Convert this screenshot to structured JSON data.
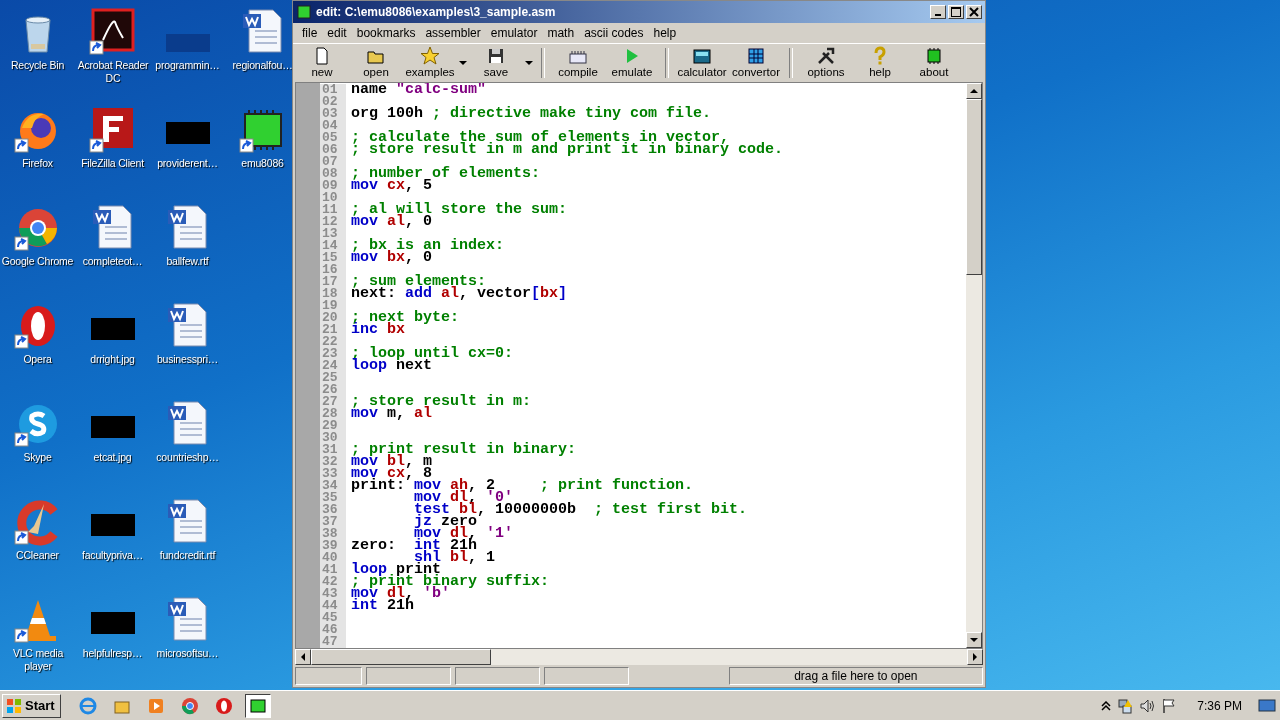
{
  "desktop_icons": [
    {
      "label": "Recycle Bin",
      "kind": "recycle",
      "shortcut": false
    },
    {
      "label": "Firefox",
      "kind": "firefox",
      "shortcut": true
    },
    {
      "label": "Google Chrome",
      "kind": "chrome",
      "shortcut": true
    },
    {
      "label": "Opera",
      "kind": "opera",
      "shortcut": true
    },
    {
      "label": "Skype",
      "kind": "skype",
      "shortcut": true
    },
    {
      "label": "CCleaner",
      "kind": "cleaner",
      "shortcut": true
    },
    {
      "label": "VLC media player",
      "kind": "cone",
      "shortcut": true
    },
    {
      "label": "Acrobat Reader DC",
      "kind": "pdf",
      "shortcut": true
    },
    {
      "label": "FileZilla Client",
      "kind": "ftp",
      "shortcut": true
    },
    {
      "label": "completeot…",
      "kind": "word",
      "shortcut": false
    },
    {
      "label": "drright.jpg",
      "kind": "blackout",
      "shortcut": false
    },
    {
      "label": "etcat.jpg",
      "kind": "blackout",
      "shortcut": false
    },
    {
      "label": "facultypriva…",
      "kind": "blackout",
      "shortcut": false
    },
    {
      "label": "helpfulresp…",
      "kind": "blackout",
      "shortcut": false
    },
    {
      "label": "programmin…",
      "kind": "dark",
      "shortcut": false
    },
    {
      "label": "providerent…",
      "kind": "blackout",
      "shortcut": false
    },
    {
      "label": "ballfew.rtf",
      "kind": "word",
      "shortcut": false
    },
    {
      "label": "businesspri…",
      "kind": "word",
      "shortcut": false
    },
    {
      "label": "countrieshp…",
      "kind": "word",
      "shortcut": false
    },
    {
      "label": "fundcredit.rtf",
      "kind": "word",
      "shortcut": false
    },
    {
      "label": "microsoftsu…",
      "kind": "word",
      "shortcut": false
    },
    {
      "label": "regionalfou…",
      "kind": "word",
      "shortcut": false
    },
    {
      "label": "emu8086",
      "kind": "chip",
      "shortcut": true
    }
  ],
  "window": {
    "title": "edit: C:\\emu8086\\examples\\3_sample.asm",
    "menu": [
      "file",
      "edit",
      "bookmarks",
      "assembler",
      "emulator",
      "math",
      "ascii codes",
      "help"
    ],
    "toolbar": [
      [
        {
          "label": "new",
          "kind": "page",
          "dropdown": false
        },
        {
          "label": "open",
          "kind": "folder",
          "dropdown": false
        },
        {
          "label": "examples",
          "kind": "star",
          "dropdown": true
        },
        {
          "label": "save",
          "kind": "disk",
          "dropdown": true
        }
      ],
      [
        {
          "label": "compile",
          "kind": "keyboard",
          "dropdown": false
        },
        {
          "label": "emulate",
          "kind": "play",
          "dropdown": false
        }
      ],
      [
        {
          "label": "calculator",
          "kind": "calc",
          "dropdown": false
        },
        {
          "label": "convertor",
          "kind": "grid",
          "dropdown": false
        }
      ],
      [
        {
          "label": "options",
          "kind": "tools",
          "dropdown": false
        },
        {
          "label": "help",
          "kind": "question",
          "dropdown": false
        },
        {
          "label": "about",
          "kind": "chip",
          "dropdown": false
        }
      ]
    ],
    "code_lines": [
      {
        "number": "01",
        "tokens": [
          {
            "kind": "plain",
            "text": "name "
          },
          {
            "kind": "string",
            "text": "\"calc-sum\""
          }
        ]
      },
      {
        "number": "02"
      },
      {
        "number": "03",
        "tokens": [
          {
            "kind": "plain",
            "text": "org 100h "
          },
          {
            "kind": "comment",
            "text": "; directive make tiny com file."
          }
        ]
      },
      {
        "number": "04"
      },
      {
        "number": "05",
        "tokens": [
          {
            "kind": "comment",
            "text": "; calculate the sum of elements in vector,"
          }
        ]
      },
      {
        "number": "06",
        "tokens": [
          {
            "kind": "comment",
            "text": "; store result in m and print it in binary code."
          }
        ]
      },
      {
        "number": "07"
      },
      {
        "number": "08",
        "tokens": [
          {
            "kind": "comment",
            "text": "; number of elements:"
          }
        ]
      },
      {
        "number": "09",
        "tokens": [
          {
            "kind": "keyword",
            "text": "mov "
          },
          {
            "kind": "register",
            "text": "cx"
          },
          {
            "kind": "plain",
            "text": ", 5"
          }
        ]
      },
      {
        "number": "10"
      },
      {
        "number": "11",
        "tokens": [
          {
            "kind": "comment",
            "text": "; al will store the sum:"
          }
        ]
      },
      {
        "number": "12",
        "tokens": [
          {
            "kind": "keyword",
            "text": "mov "
          },
          {
            "kind": "register",
            "text": "al"
          },
          {
            "kind": "plain",
            "text": ", 0"
          }
        ]
      },
      {
        "number": "13"
      },
      {
        "number": "14",
        "tokens": [
          {
            "kind": "comment",
            "text": "; bx is an index:"
          }
        ]
      },
      {
        "number": "15",
        "tokens": [
          {
            "kind": "keyword",
            "text": "mov "
          },
          {
            "kind": "register",
            "text": "bx"
          },
          {
            "kind": "plain",
            "text": ", 0"
          }
        ]
      },
      {
        "number": "16"
      },
      {
        "number": "17",
        "tokens": [
          {
            "kind": "comment",
            "text": "; sum elements:"
          }
        ]
      },
      {
        "number": "18",
        "tokens": [
          {
            "kind": "plain",
            "text": "next: "
          },
          {
            "kind": "keyword",
            "text": "add "
          },
          {
            "kind": "register",
            "text": "al"
          },
          {
            "kind": "plain",
            "text": ", vector"
          },
          {
            "kind": "keyword",
            "text": "["
          },
          {
            "kind": "register",
            "text": "bx"
          },
          {
            "kind": "keyword",
            "text": "]"
          }
        ]
      },
      {
        "number": "19"
      },
      {
        "number": "20",
        "tokens": [
          {
            "kind": "comment",
            "text": "; next byte:"
          }
        ]
      },
      {
        "number": "21",
        "tokens": [
          {
            "kind": "keyword",
            "text": "inc "
          },
          {
            "kind": "register",
            "text": "bx"
          }
        ]
      },
      {
        "number": "22"
      },
      {
        "number": "23",
        "tokens": [
          {
            "kind": "comment",
            "text": "; loop until cx=0:"
          }
        ]
      },
      {
        "number": "24",
        "tokens": [
          {
            "kind": "keyword",
            "text": "loop "
          },
          {
            "kind": "plain",
            "text": "next"
          }
        ]
      },
      {
        "number": "25"
      },
      {
        "number": "26"
      },
      {
        "number": "27",
        "tokens": [
          {
            "kind": "comment",
            "text": "; store result in m:"
          }
        ]
      },
      {
        "number": "28",
        "tokens": [
          {
            "kind": "keyword",
            "text": "mov "
          },
          {
            "kind": "plain",
            "text": "m, "
          },
          {
            "kind": "register",
            "text": "al"
          }
        ]
      },
      {
        "number": "29"
      },
      {
        "number": "30"
      },
      {
        "number": "31",
        "tokens": [
          {
            "kind": "comment",
            "text": "; print result in binary:"
          }
        ]
      },
      {
        "number": "32",
        "tokens": [
          {
            "kind": "keyword",
            "text": "mov "
          },
          {
            "kind": "register",
            "text": "bl"
          },
          {
            "kind": "plain",
            "text": ", m"
          }
        ]
      },
      {
        "number": "33",
        "tokens": [
          {
            "kind": "keyword",
            "text": "mov "
          },
          {
            "kind": "register",
            "text": "cx"
          },
          {
            "kind": "plain",
            "text": ", 8"
          }
        ]
      },
      {
        "number": "34",
        "tokens": [
          {
            "kind": "plain",
            "text": "print: "
          },
          {
            "kind": "keyword",
            "text": "mov "
          },
          {
            "kind": "register",
            "text": "ah"
          },
          {
            "kind": "plain",
            "text": ", 2     "
          },
          {
            "kind": "comment",
            "text": "; print function."
          }
        ]
      },
      {
        "number": "35",
        "tokens": [
          {
            "kind": "keyword",
            "text": "       mov "
          },
          {
            "kind": "register",
            "text": "dl"
          },
          {
            "kind": "plain",
            "text": ", "
          },
          {
            "kind": "string",
            "text": "'0'"
          }
        ]
      },
      {
        "number": "36",
        "tokens": [
          {
            "kind": "keyword",
            "text": "       test "
          },
          {
            "kind": "register",
            "text": "bl"
          },
          {
            "kind": "plain",
            "text": ", 10000000b  "
          },
          {
            "kind": "comment",
            "text": "; test first bit."
          }
        ]
      },
      {
        "number": "37",
        "tokens": [
          {
            "kind": "keyword",
            "text": "       jz "
          },
          {
            "kind": "plain",
            "text": "zero"
          }
        ]
      },
      {
        "number": "38",
        "tokens": [
          {
            "kind": "keyword",
            "text": "       mov "
          },
          {
            "kind": "register",
            "text": "dl"
          },
          {
            "kind": "plain",
            "text": ", "
          },
          {
            "kind": "string",
            "text": "'1'"
          }
        ]
      },
      {
        "number": "39",
        "tokens": [
          {
            "kind": "plain",
            "text": "zero:  "
          },
          {
            "kind": "keyword",
            "text": "int "
          },
          {
            "kind": "plain",
            "text": "21h"
          }
        ]
      },
      {
        "number": "40",
        "tokens": [
          {
            "kind": "keyword",
            "text": "       shl "
          },
          {
            "kind": "register",
            "text": "bl"
          },
          {
            "kind": "plain",
            "text": ", 1"
          }
        ]
      },
      {
        "number": "41",
        "tokens": [
          {
            "kind": "keyword",
            "text": "loop "
          },
          {
            "kind": "plain",
            "text": "print"
          }
        ]
      },
      {
        "number": "42",
        "tokens": [
          {
            "kind": "comment",
            "text": "; print binary suffix:"
          }
        ]
      },
      {
        "number": "43",
        "tokens": [
          {
            "kind": "keyword",
            "text": "mov "
          },
          {
            "kind": "register",
            "text": "dl"
          },
          {
            "kind": "plain",
            "text": ", "
          },
          {
            "kind": "string",
            "text": "'b'"
          }
        ]
      },
      {
        "number": "44",
        "tokens": [
          {
            "kind": "keyword",
            "text": "int "
          },
          {
            "kind": "plain",
            "text": "21h"
          }
        ]
      },
      {
        "number": "45"
      },
      {
        "number": "46"
      },
      {
        "number": "47"
      }
    ],
    "status_text": "drag a file here to open"
  },
  "taskbar": {
    "start_label": "Start",
    "apps": [
      {
        "kind": "ie",
        "selected": false
      },
      {
        "kind": "explorer",
        "selected": false
      },
      {
        "kind": "media",
        "selected": false
      },
      {
        "kind": "chrome",
        "selected": false
      },
      {
        "kind": "opera",
        "selected": false
      },
      {
        "kind": "chip",
        "selected": true
      }
    ],
    "clock": "7:36 PM"
  }
}
